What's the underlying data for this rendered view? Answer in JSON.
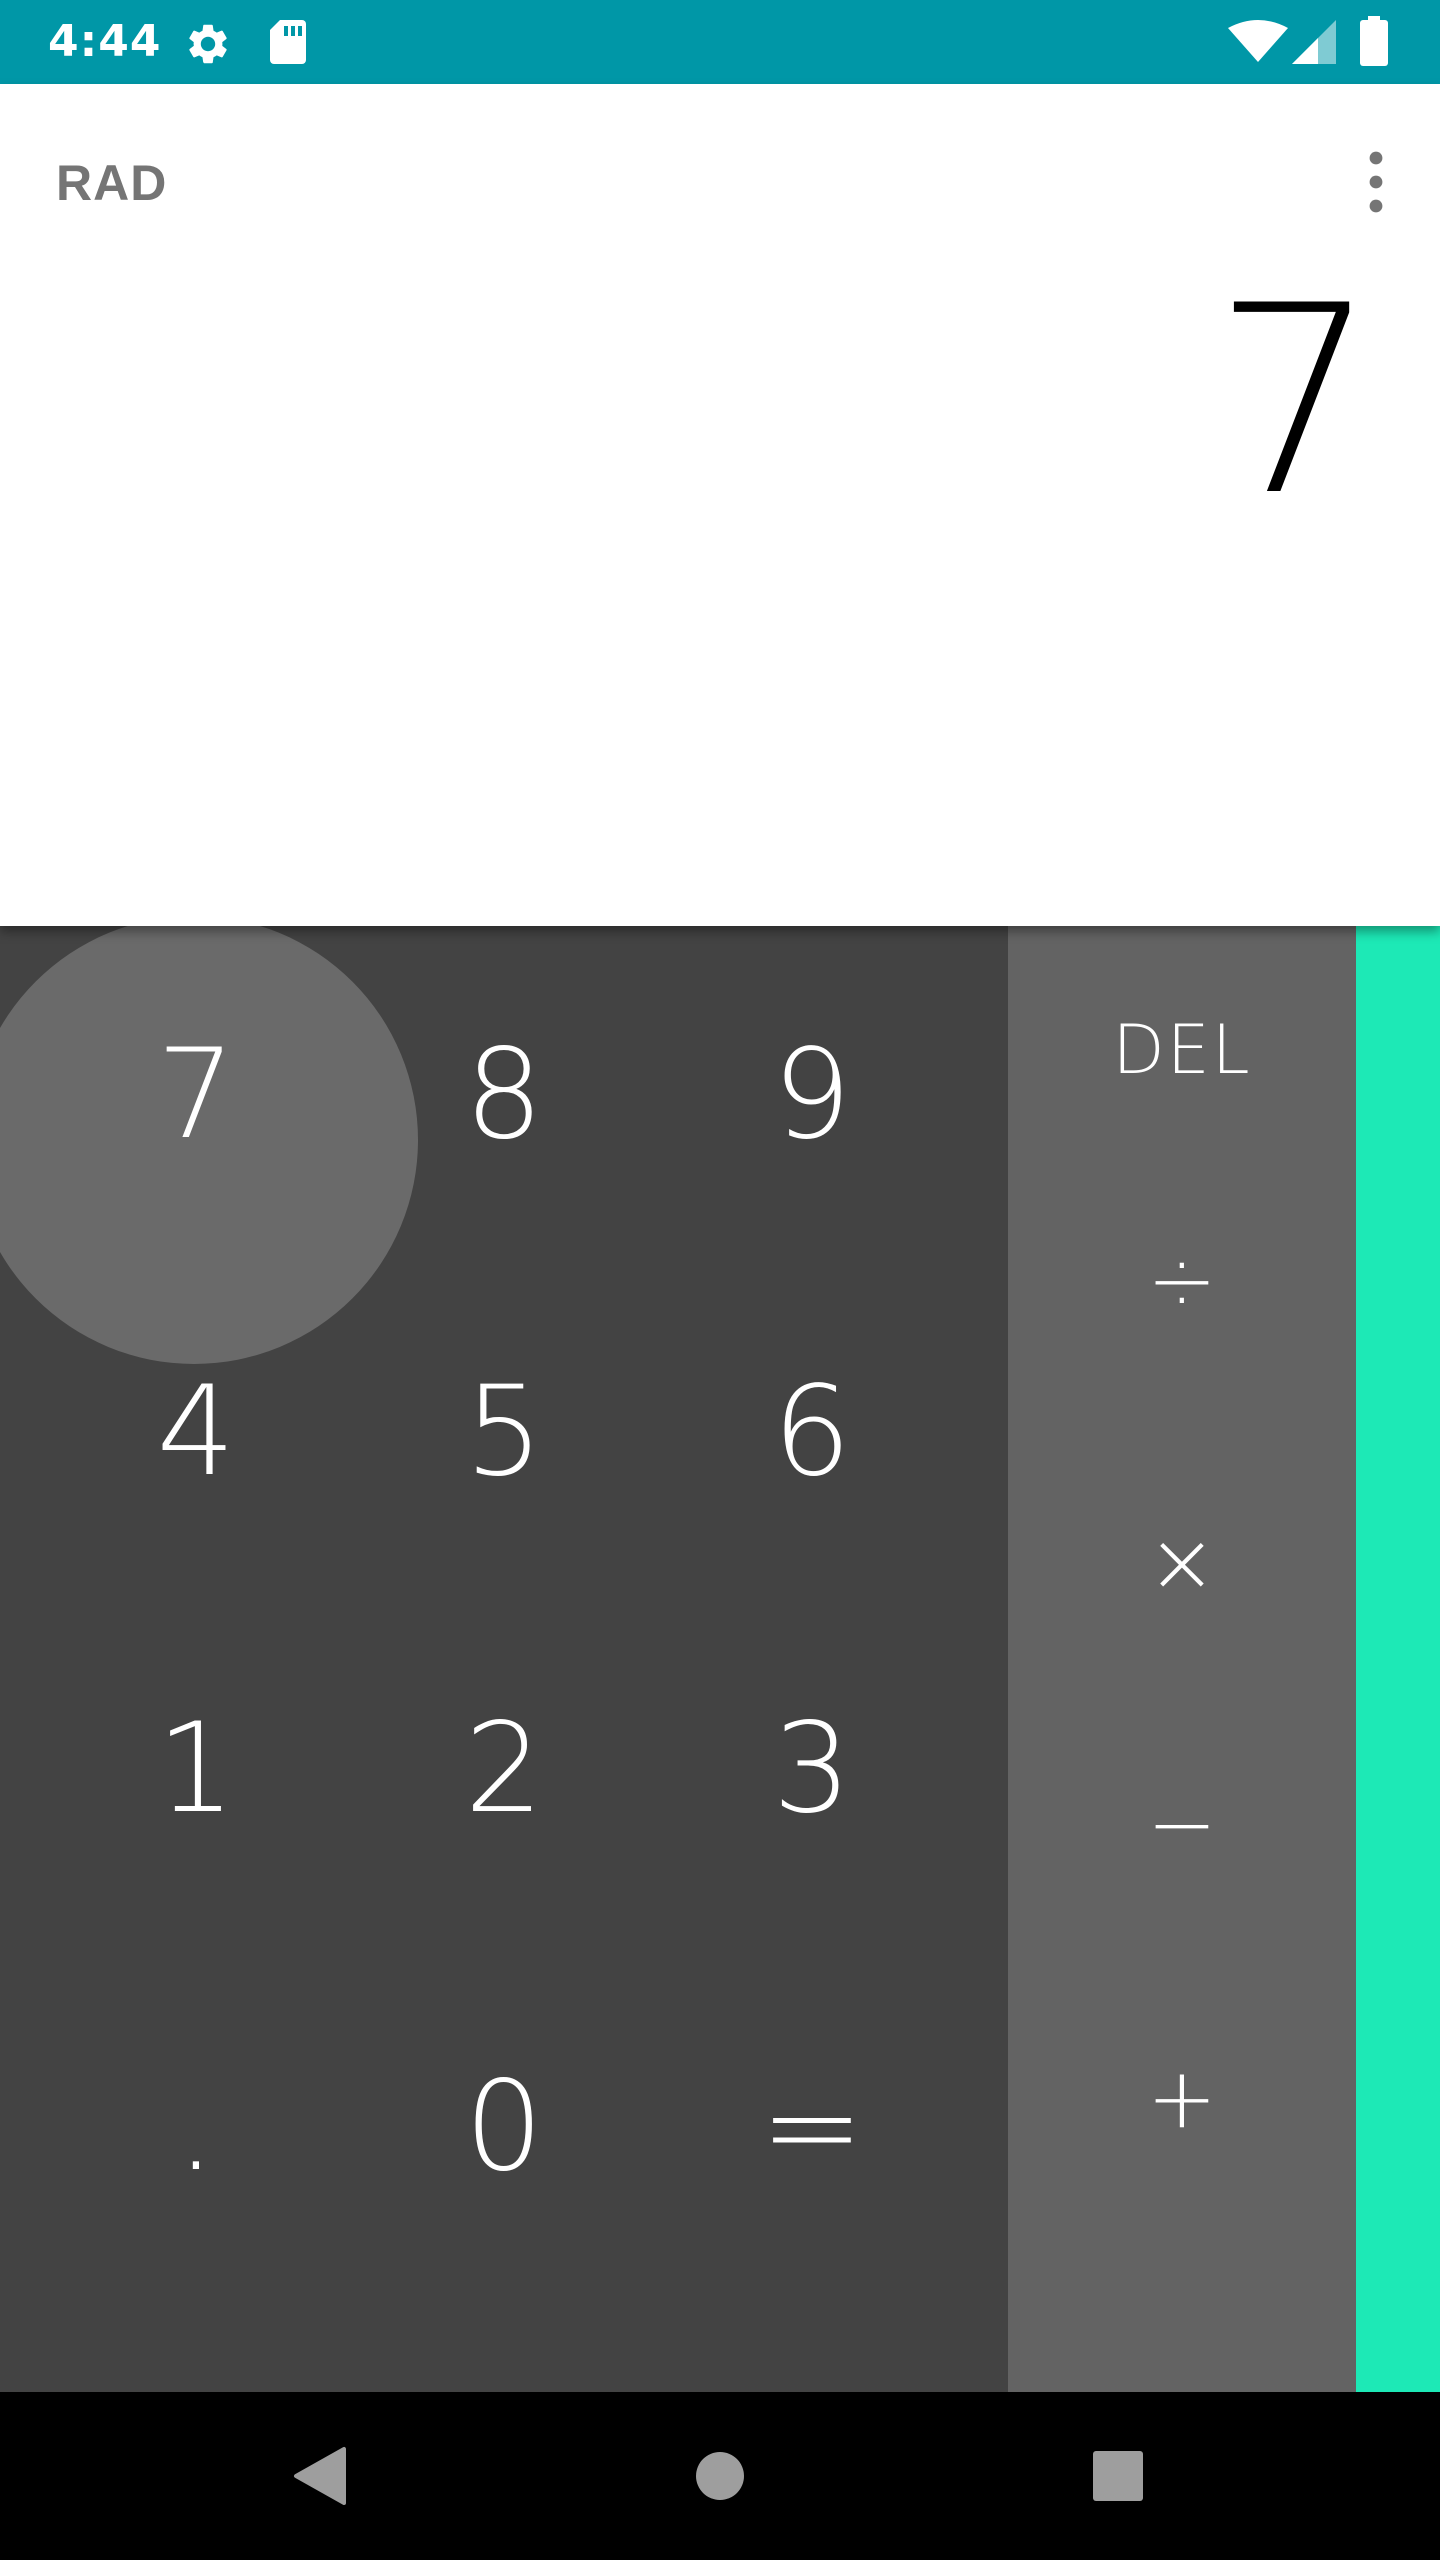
{
  "status_bar": {
    "time": "4:44",
    "icons": [
      "gear-icon",
      "sd-card-icon",
      "wifi-icon",
      "signal-icon",
      "battery-icon"
    ],
    "background": "#0097a7"
  },
  "display": {
    "mode": "RAD",
    "formula": "7",
    "menu_icon": "overflow-menu-icon"
  },
  "keypad": {
    "digits": {
      "seven": "7",
      "eight": "8",
      "nine": "9",
      "four": "4",
      "five": "5",
      "six": "6",
      "one": "1",
      "two": "2",
      "three": "3",
      "decimal": ".",
      "zero": "0",
      "equals": "="
    },
    "operators": {
      "delete": "DEL",
      "divide": "÷",
      "multiply": "×",
      "subtract": "−",
      "add": "+"
    },
    "numeric_background": "#434343",
    "operator_background": "#636363",
    "accent": "#1de9b6",
    "pressed_key": "7"
  },
  "nav_bar": {
    "icons": [
      "back-icon",
      "home-icon",
      "recents-icon"
    ]
  }
}
